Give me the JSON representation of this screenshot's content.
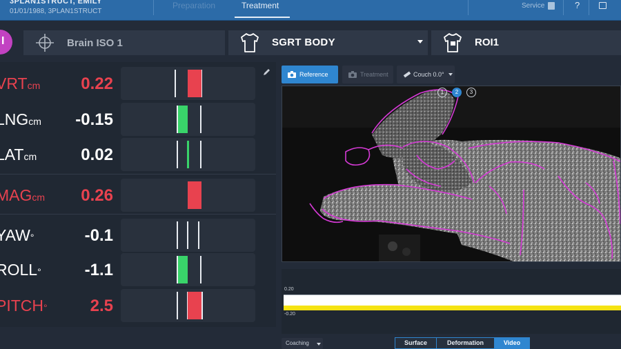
{
  "patient": {
    "name": "3PLAN1STRUCT, EMILY",
    "subline": "01/01/1988, 3PLAN1STRUCT"
  },
  "tabs": {
    "preparation": "Preparation",
    "treatment": "Treatment"
  },
  "topbar": {
    "service": "Service"
  },
  "header": {
    "avatar_letter": "I",
    "iso_name": "Brain ISO 1",
    "surface_name": "SGRT BODY",
    "roi_name": "ROI1"
  },
  "metrics": [
    {
      "label": "VRT",
      "unit": "cm",
      "value": "0.22",
      "status": "red",
      "bar": "red"
    },
    {
      "label": "LNG",
      "unit": "cm",
      "value": "-0.15",
      "status": "white",
      "bar": "green"
    },
    {
      "label": "LAT",
      "unit": "cm",
      "value": "0.02",
      "status": "white",
      "bar": "green-thin"
    },
    {
      "label": "MAG",
      "unit": "cm",
      "value": "0.26",
      "status": "red",
      "bar": "red"
    },
    {
      "label": "YAW",
      "unit": "°",
      "value": "-0.1",
      "status": "white",
      "bar": "none"
    },
    {
      "label": "ROLL",
      "unit": "°",
      "value": "-1.1",
      "status": "white",
      "bar": "green"
    },
    {
      "label": "PITCH",
      "unit": "°",
      "value": "2.5",
      "status": "red",
      "bar": "red"
    }
  ],
  "view": {
    "reference": "Reference",
    "treatment": "Treatment",
    "couch": "Couch 0.0°",
    "viewpoints": [
      "1",
      "2",
      "3"
    ]
  },
  "graph": {
    "top_label": "0.20",
    "bottom_label": "-0.20"
  },
  "bottom": {
    "coaching": "Coaching",
    "surface": "Surface",
    "deformation": "Deformation",
    "video": "Video"
  },
  "colors": {
    "accent": "#2f86d0",
    "topbar": "#2c6ba8",
    "red": "#e8424f",
    "green": "#39d46a",
    "band": "#f5e313",
    "avatar": "#c242c2",
    "contour": "#d63ad6"
  }
}
